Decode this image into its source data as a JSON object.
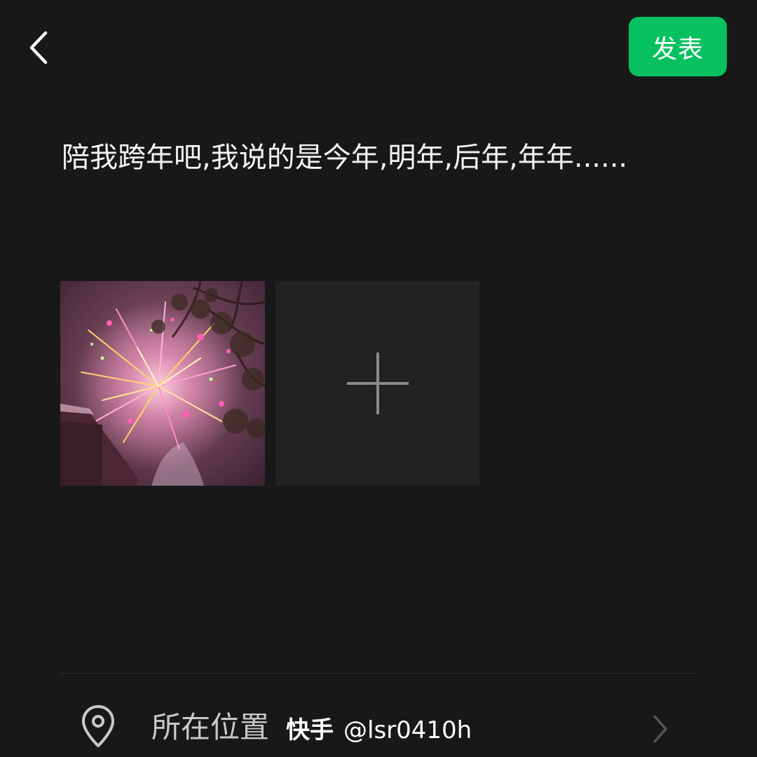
{
  "header": {
    "back_icon": "chevron-left-icon",
    "publish_label": "发表",
    "publish_color": "#07c160"
  },
  "post": {
    "text": "陪我跨年吧,我说的是今年,明年,后年,年年......"
  },
  "media": {
    "photos": [
      {
        "description": "fireworks-photo"
      }
    ],
    "add_icon": "plus-icon"
  },
  "location": {
    "icon": "location-pin-icon",
    "label": "所在位置",
    "chevron_icon": "chevron-right-icon"
  },
  "watermark": {
    "app": "快手",
    "handle": "@lsr0410h"
  }
}
